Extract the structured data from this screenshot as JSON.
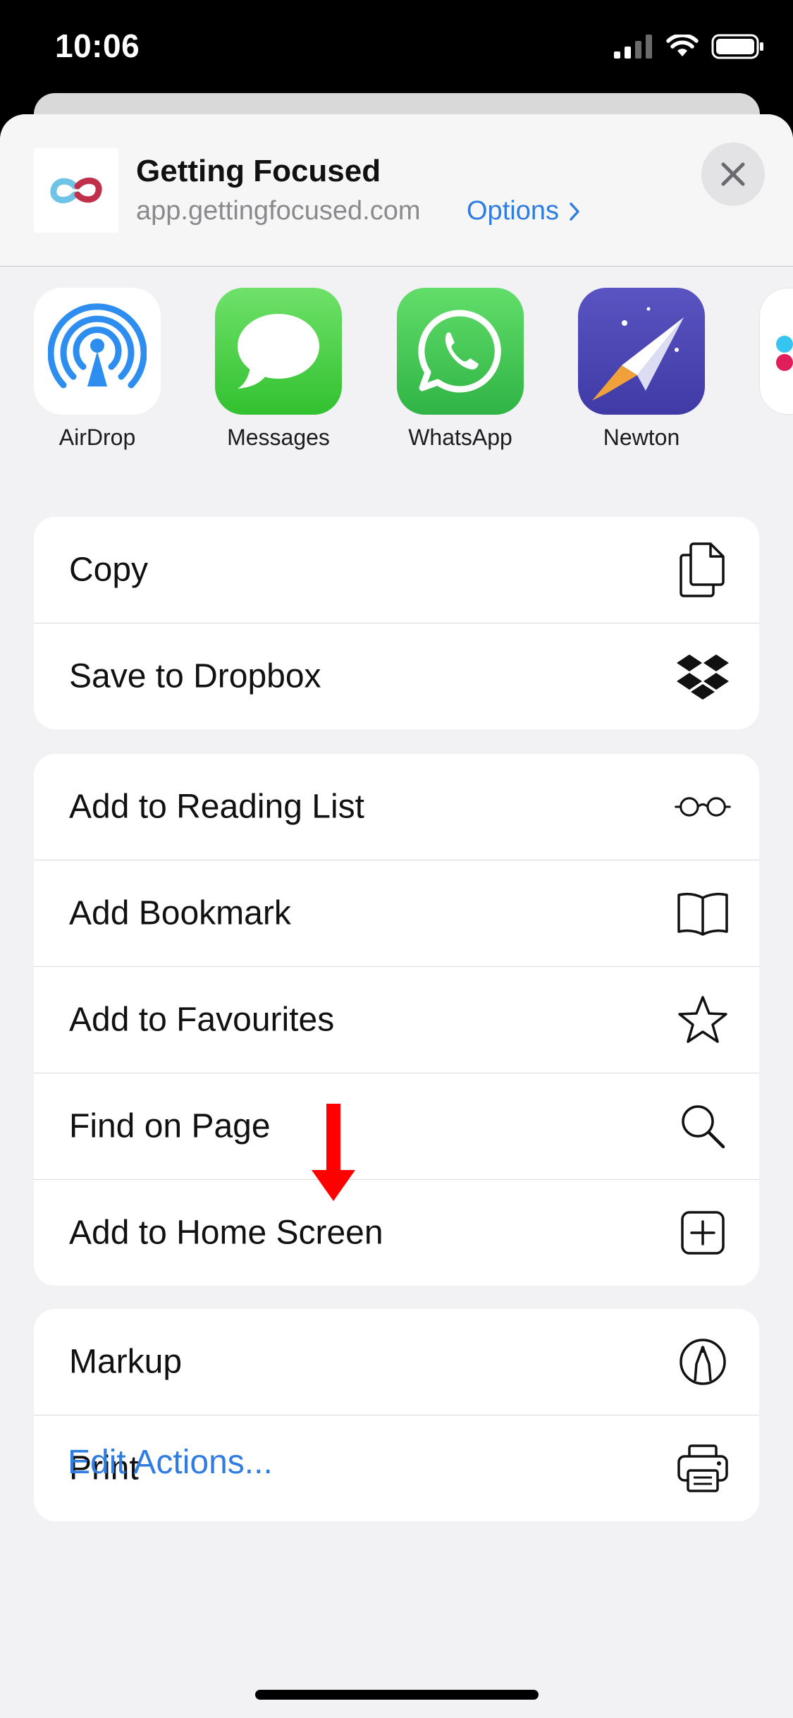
{
  "status_bar": {
    "time": "10:06"
  },
  "header": {
    "title": "Getting Focused",
    "url": "app.gettingfocused.com",
    "options_label": "Options"
  },
  "apps": [
    {
      "label": "AirDrop",
      "icon": "airdrop-icon"
    },
    {
      "label": "Messages",
      "icon": "messages-icon"
    },
    {
      "label": "WhatsApp",
      "icon": "whatsapp-icon"
    },
    {
      "label": "Newton",
      "icon": "newton-icon"
    }
  ],
  "groups": {
    "group1": [
      {
        "label": "Copy",
        "icon": "copy-icon"
      },
      {
        "label": "Save to Dropbox",
        "icon": "dropbox-icon"
      }
    ],
    "group2": [
      {
        "label": "Add to Reading List",
        "icon": "glasses-icon"
      },
      {
        "label": "Add Bookmark",
        "icon": "book-icon"
      },
      {
        "label": "Add to Favourites",
        "icon": "star-icon"
      },
      {
        "label": "Find on Page",
        "icon": "search-icon"
      },
      {
        "label": "Add to Home Screen",
        "icon": "plus-square-icon"
      }
    ],
    "group3": [
      {
        "label": "Markup",
        "icon": "markup-icon"
      },
      {
        "label": "Print",
        "icon": "printer-icon"
      }
    ]
  },
  "edit_actions_label": "Edit Actions...",
  "colors": {
    "accent": "#2f7de1",
    "annotation_arrow": "#ff0000"
  }
}
